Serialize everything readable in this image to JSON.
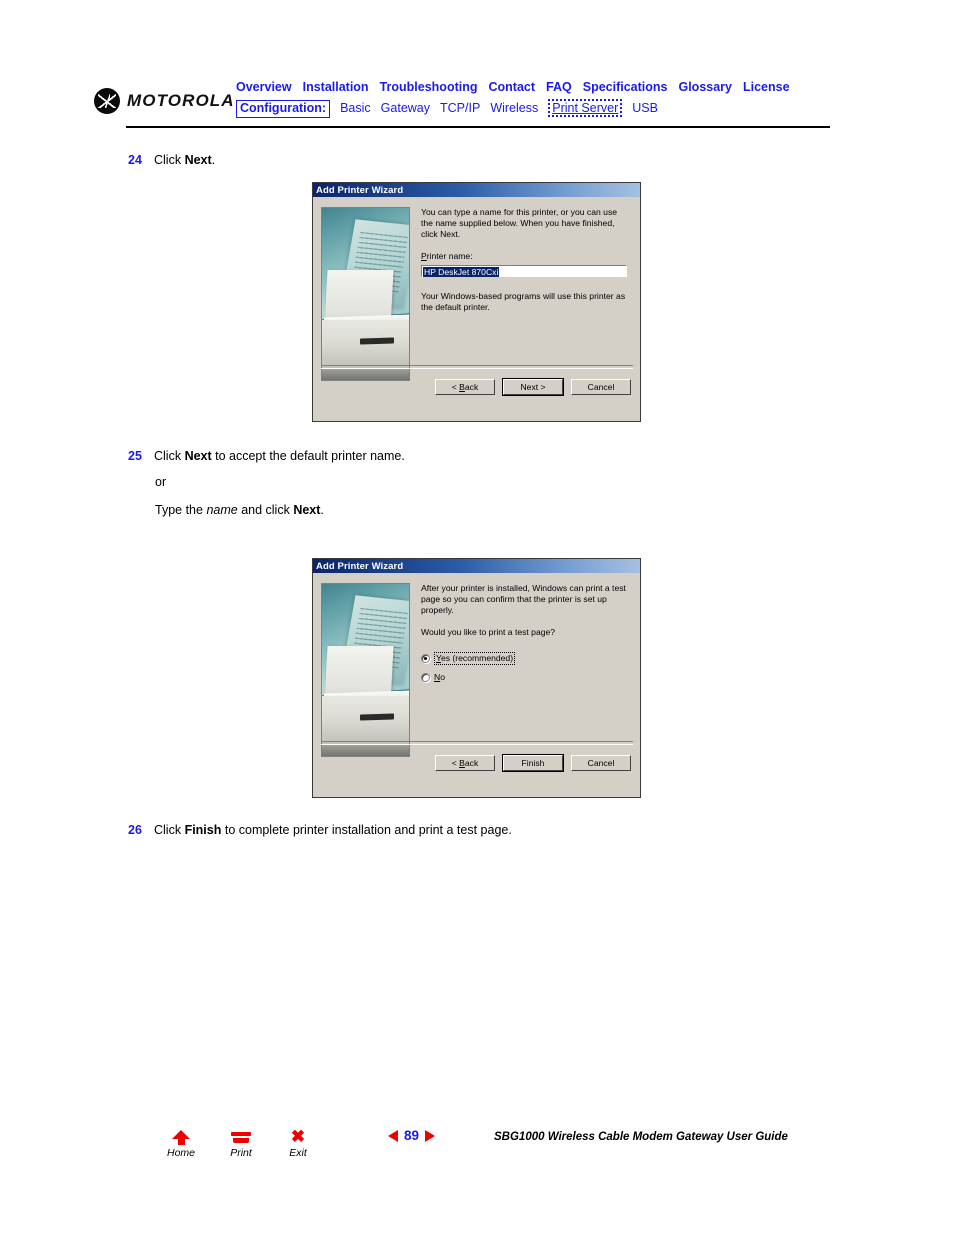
{
  "header": {
    "brand": "MOTOROLA",
    "nav_primary": [
      {
        "label": "Overview"
      },
      {
        "label": "Installation"
      },
      {
        "label": "Troubleshooting"
      },
      {
        "label": "Contact"
      },
      {
        "label": "FAQ"
      },
      {
        "label": "Specifications"
      },
      {
        "label": "Glossary"
      },
      {
        "label": "License"
      }
    ],
    "nav_secondary_label": "Configuration:",
    "nav_secondary": [
      {
        "label": "Basic",
        "state": "normal"
      },
      {
        "label": "Gateway",
        "state": "normal"
      },
      {
        "label": "TCP/IP",
        "state": "normal"
      },
      {
        "label": "Wireless",
        "state": "normal"
      },
      {
        "label": "Print Server",
        "state": "current"
      },
      {
        "label": "USB",
        "state": "normal"
      }
    ]
  },
  "steps": {
    "step24": {
      "number": "24",
      "text_pre": "Click ",
      "text_bold": "Next",
      "text_post": "."
    },
    "step25": {
      "number": "25",
      "line1_pre": "Click ",
      "line1_bold": "Next",
      "line1_post": " to accept the default printer name.",
      "line2": "or",
      "line3_pre": "Type the ",
      "line3_italic": "name",
      "line3_mid": " and click ",
      "line3_bold": "Next",
      "line3_post": "."
    },
    "step26": {
      "number": "26",
      "text_pre": "Click ",
      "text_bold": "Finish",
      "text_post": " to complete printer installation and print a test page."
    }
  },
  "dialog1": {
    "title": "Add Printer Wizard",
    "paragraph1": "You can type a name for this printer, or you can use the name supplied below. When you have finished, click Next.",
    "field_label_underlined": "P",
    "field_label_rest": "rinter name:",
    "field_value": "HP DeskJet 870Cxi",
    "paragraph2": "Your Windows-based programs will use this printer as the default printer.",
    "buttons": {
      "back_prefix": "< ",
      "back_underlined": "B",
      "back_rest": "ack",
      "next": "Next >",
      "cancel": "Cancel"
    }
  },
  "dialog2": {
    "title": "Add Printer Wizard",
    "paragraph1": "After your printer is installed, Windows can print a test page so you can confirm that the printer is set up properly.",
    "paragraph2": "Would you like to print a test page?",
    "options": [
      {
        "label_underlined": "Y",
        "label_rest": "es (recommended)",
        "selected": true,
        "focused": true
      },
      {
        "label_underlined": "N",
        "label_rest": "o",
        "selected": false,
        "focused": false
      }
    ],
    "buttons": {
      "back_prefix": "< ",
      "back_underlined": "B",
      "back_rest": "ack",
      "finish": "Finish",
      "cancel": "Cancel"
    }
  },
  "footer": {
    "icons": [
      {
        "label": "Home",
        "icon": "home-icon"
      },
      {
        "label": "Print",
        "icon": "printer-icon"
      },
      {
        "label": "Exit",
        "icon": "close-x-icon"
      }
    ],
    "page_number": "89",
    "prev_icon": "triangle-left-icon",
    "next_icon": "triangle-right-icon",
    "document_title": "SBG1000 Wireless Cable Modem Gateway User Guide"
  },
  "colors": {
    "link_blue": "#1a1aee",
    "accent_red": "#ee0000",
    "dialog_face": "#d4d0c8",
    "titlebar_dark": "#0a246a"
  }
}
